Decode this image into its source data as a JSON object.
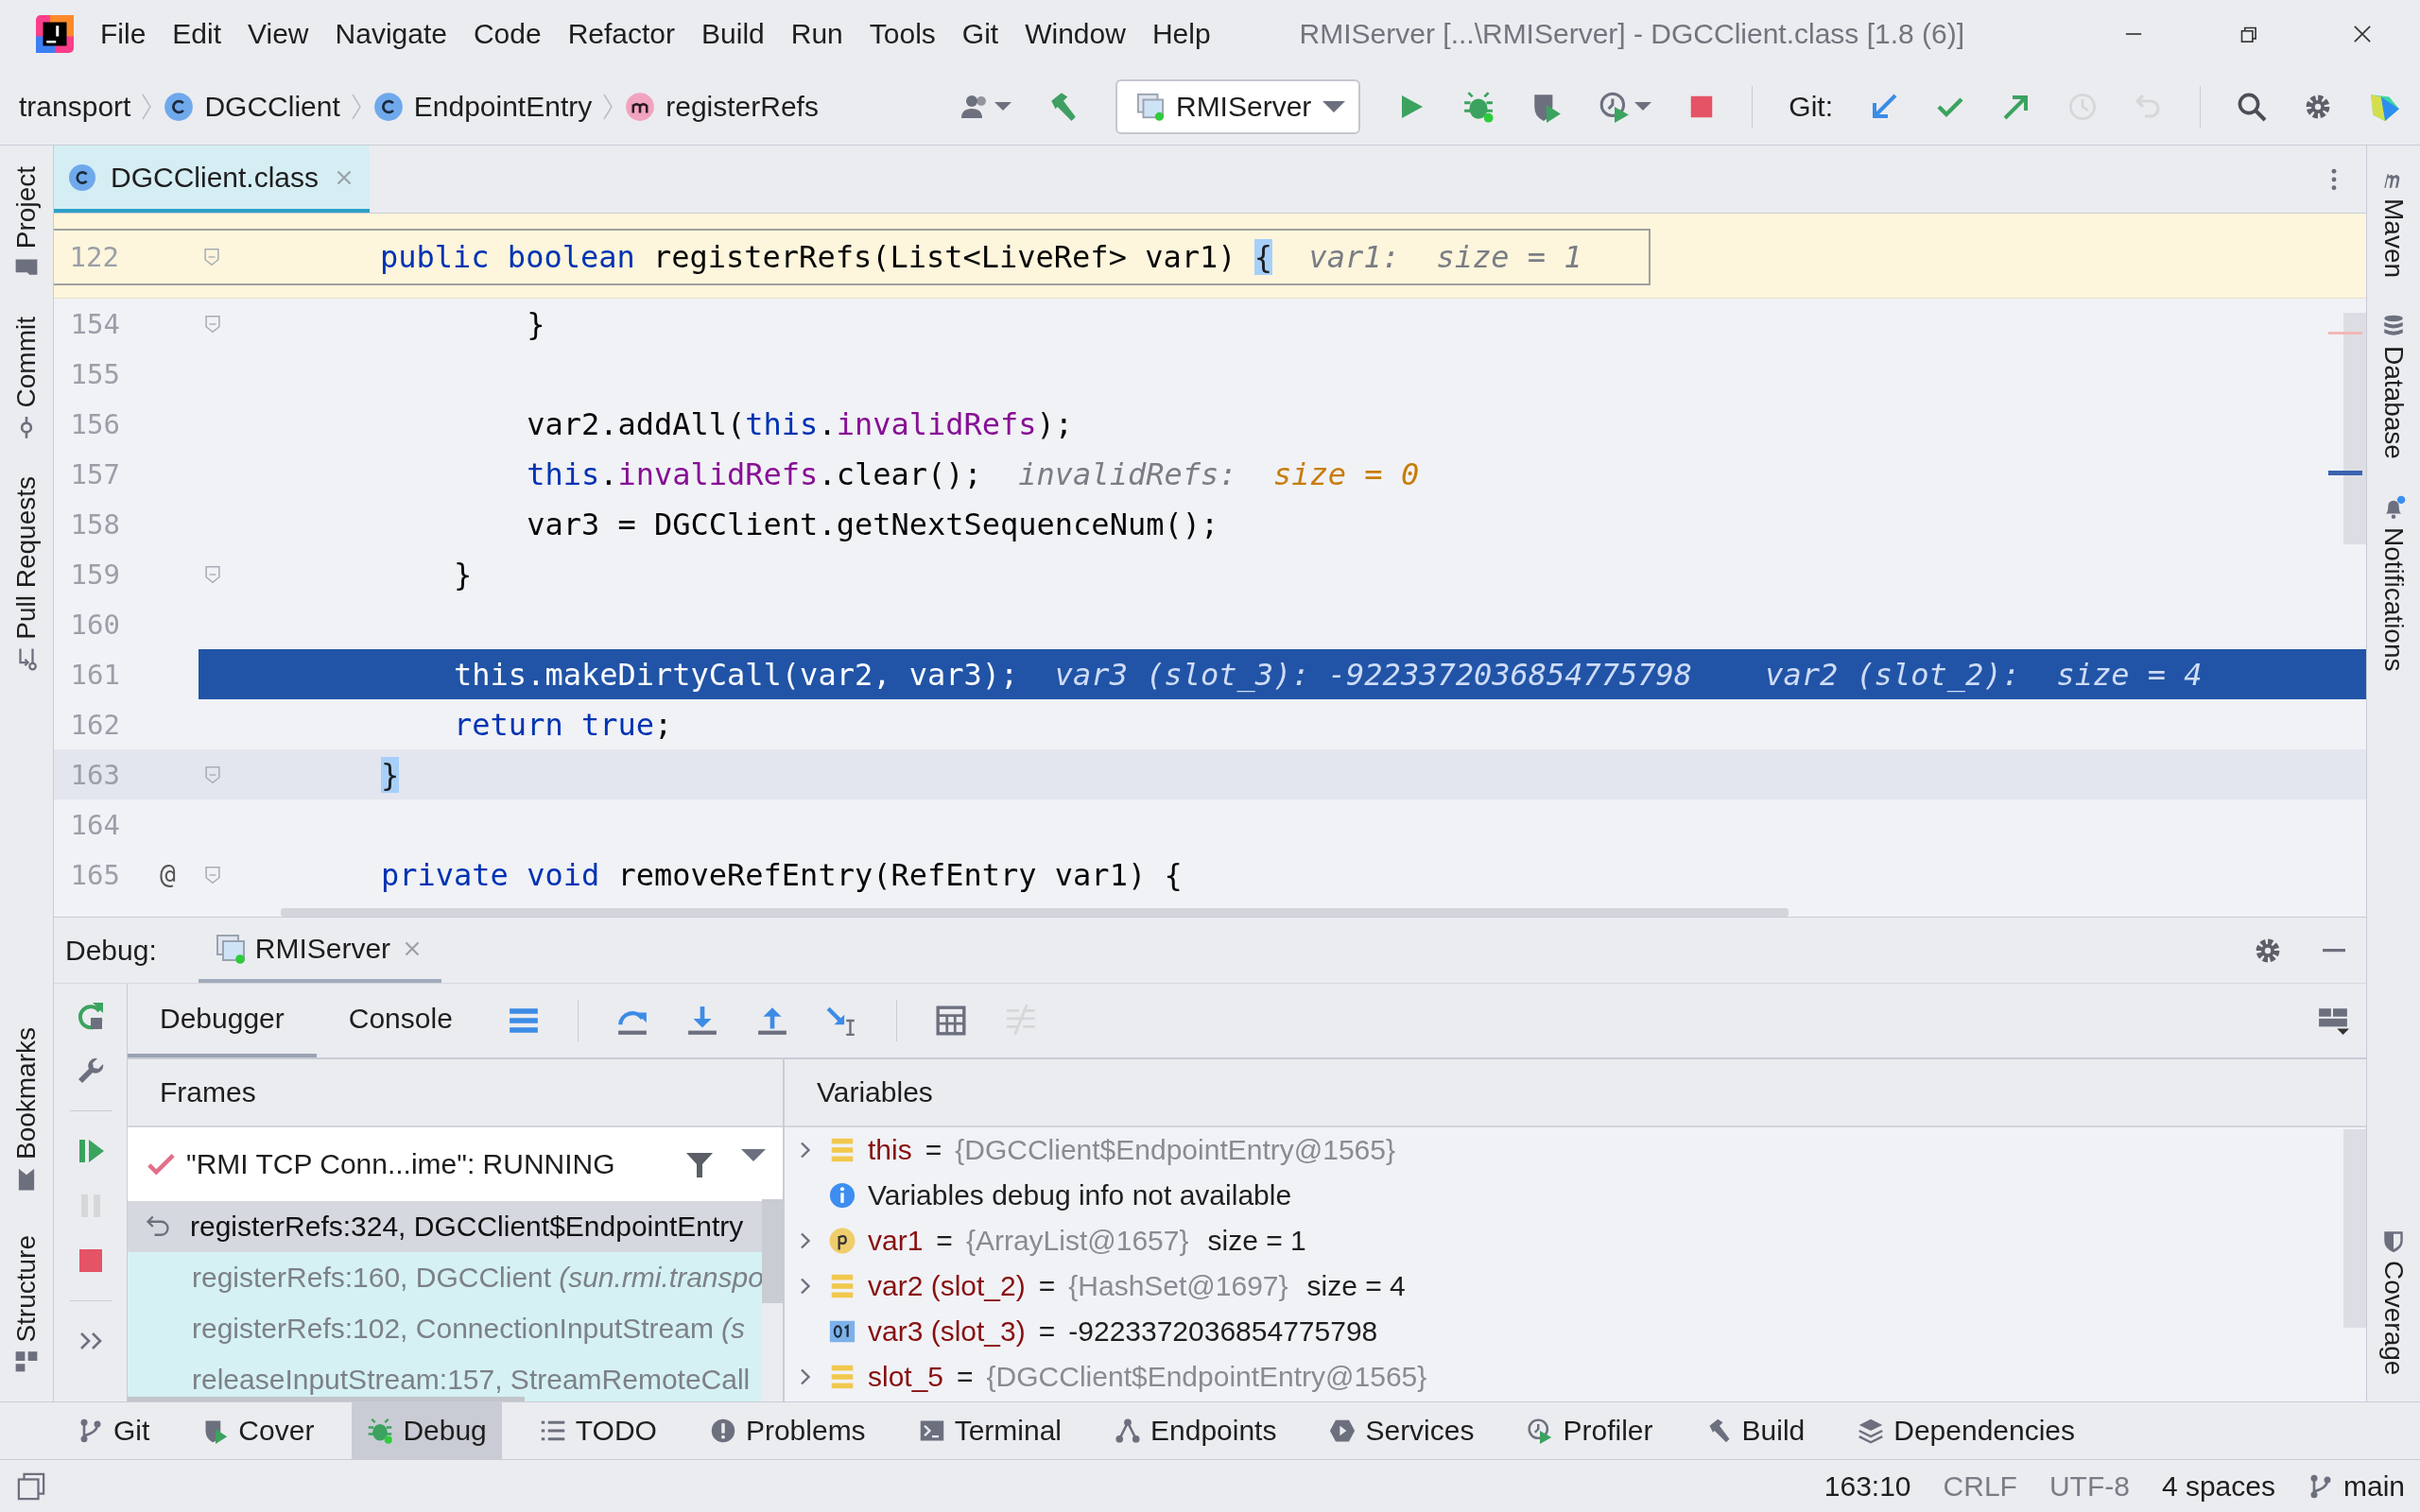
{
  "window": {
    "title": "RMIServer [...\\RMIServer] - DGCClient.class [1.8 (6)]"
  },
  "menu": [
    "File",
    "Edit",
    "View",
    "Navigate",
    "Code",
    "Refactor",
    "Build",
    "Run",
    "Tools",
    "Git",
    "Window",
    "Help"
  ],
  "breadcrumbs": [
    {
      "label": "transport",
      "kind": "package"
    },
    {
      "label": "DGCClient",
      "kind": "class"
    },
    {
      "label": "EndpointEntry",
      "kind": "class"
    },
    {
      "label": "registerRefs",
      "kind": "method"
    }
  ],
  "run_config": {
    "label": "RMIServer"
  },
  "git": {
    "label": "Git:",
    "actions": [
      {
        "kind": "update",
        "disabled": false
      },
      {
        "kind": "commit",
        "disabled": false
      },
      {
        "kind": "push",
        "disabled": false
      },
      {
        "kind": "history",
        "disabled": true
      },
      {
        "kind": "rollback",
        "disabled": true
      }
    ]
  },
  "left_stripe": {
    "top": [
      {
        "label": "Project",
        "kind": "project"
      },
      {
        "label": "Commit",
        "kind": "commit"
      },
      {
        "label": "Pull Requests",
        "kind": "pull-requests"
      }
    ],
    "bottom": [
      {
        "label": "Bookmarks",
        "kind": "bookmarks"
      },
      {
        "label": "Structure",
        "kind": "structure"
      }
    ]
  },
  "right_stripe": {
    "top": [
      {
        "label": "Maven",
        "kind": "maven"
      },
      {
        "label": "Database",
        "kind": "database"
      },
      {
        "label": "Notifications",
        "kind": "notifications"
      }
    ],
    "bottom": [
      {
        "label": "Coverage",
        "kind": "coverage"
      }
    ]
  },
  "editor": {
    "tabs": [
      {
        "label": "DGCClient.class",
        "selected": true
      }
    ],
    "sticky": {
      "number": "122",
      "fold": true,
      "tokens": [
        {
          "text": "public boolean",
          "kind": "kw"
        },
        {
          "text": " registerRefs(List<LiveRef> var1) ",
          "kind": "plain"
        },
        {
          "text": "{",
          "kind": "brace"
        },
        {
          "text": "var1:",
          "kind": "hint"
        },
        {
          "text": "size = 1",
          "kind": "hint-value"
        }
      ]
    },
    "lines": [
      {
        "number": "154",
        "fold": true,
        "execution": false,
        "caret": false,
        "tokens": [
          {
            "text": "        }",
            "kind": "plain"
          }
        ]
      },
      {
        "number": "155",
        "fold": false,
        "execution": false,
        "caret": false
      },
      {
        "number": "156",
        "fold": false,
        "execution": false,
        "caret": false,
        "tokens": [
          {
            "text": "        var2.addAll(",
            "kind": "plain"
          },
          {
            "text": "this",
            "kind": "kw"
          },
          {
            "text": ".",
            "kind": "plain"
          },
          {
            "text": "invalidRefs",
            "kind": "field"
          },
          {
            "text": ");",
            "kind": "plain"
          }
        ]
      },
      {
        "number": "157",
        "fold": false,
        "execution": false,
        "caret": false,
        "tokens": [
          {
            "text": "        this",
            "kind": "kw"
          },
          {
            "text": ".",
            "kind": "plain"
          },
          {
            "text": "invalidRefs",
            "kind": "field"
          },
          {
            "text": ".clear();",
            "kind": "plain"
          },
          {
            "text": "invalidRefs:",
            "kind": "hint"
          },
          {
            "text": "size = 0",
            "kind": "hint-changed"
          }
        ]
      },
      {
        "number": "158",
        "fold": false,
        "execution": false,
        "caret": false,
        "tokens": [
          {
            "text": "        var3 = DGCClient.getNextSequenceNum();",
            "kind": "plain"
          }
        ]
      },
      {
        "number": "159",
        "fold": true,
        "execution": false,
        "caret": false,
        "tokens": [
          {
            "text": "    }",
            "kind": "plain"
          }
        ]
      },
      {
        "number": "160",
        "fold": false,
        "execution": false,
        "caret": false
      },
      {
        "number": "161",
        "fold": false,
        "execution": true,
        "caret": false,
        "tokens": [
          {
            "text": "    this.makeDirtyCall(var2, var3);",
            "kind": "plain"
          },
          {
            "text": "var3 (slot_3): -9223372036854775798",
            "kind": "hint"
          },
          {
            "text": "var2 (slot_2):",
            "kind": "hint"
          },
          {
            "text": "size = 4",
            "kind": "hint-value"
          }
        ]
      },
      {
        "number": "162",
        "fold": false,
        "execution": false,
        "caret": false,
        "tokens": [
          {
            "text": "    return true",
            "kind": "kw"
          },
          {
            "text": ";",
            "kind": "plain"
          }
        ]
      },
      {
        "number": "163",
        "fold": true,
        "execution": false,
        "caret": true,
        "tokens": [
          {
            "text": "}",
            "kind": "brace"
          }
        ]
      },
      {
        "number": "164",
        "fold": false,
        "execution": false,
        "caret": false
      },
      {
        "number": "165",
        "fold": true,
        "execution": false,
        "caret": false,
        "gutter_mark": "@",
        "tokens": [
          {
            "text": "private void",
            "kind": "kw"
          },
          {
            "text": " removeRefEntry(RefEntry var1) {",
            "kind": "plain"
          }
        ]
      }
    ]
  },
  "debug": {
    "label": "Debug:",
    "sessions": [
      {
        "label": "RMIServer",
        "selected": true
      }
    ],
    "side_actions": [
      {
        "kind": "rerun",
        "disabled": false
      },
      {
        "kind": "settings",
        "disabled": false
      },
      {
        "kind": "resume",
        "disabled": false
      },
      {
        "kind": "pause",
        "disabled": true
      },
      {
        "kind": "stop",
        "disabled": false
      },
      {
        "kind": "more",
        "disabled": false
      }
    ],
    "tabs": [
      {
        "label": "Debugger",
        "selected": true
      },
      {
        "label": "Console",
        "selected": false
      }
    ],
    "actions": [
      {
        "kind": "threads",
        "disabled": false
      },
      {
        "kind": "step-over",
        "disabled": false
      },
      {
        "kind": "step-into",
        "disabled": false
      },
      {
        "kind": "step-out",
        "disabled": false
      },
      {
        "kind": "run-to-cursor",
        "disabled": false
      },
      {
        "kind": "evaluate",
        "disabled": false
      },
      {
        "kind": "trace",
        "disabled": true
      }
    ],
    "frames": {
      "title": "Frames",
      "thread": "\"RMI TCP Conn...ime\": RUNNING",
      "items": [
        {
          "method": "registerRefs:324, DGCClient$EndpointEntry",
          "selected": true,
          "library": false
        },
        {
          "method": "registerRefs:160, DGCClient",
          "package": "(sun.rmi.transpo",
          "selected": false,
          "library": true
        },
        {
          "method": "registerRefs:102, ConnectionInputStream",
          "package": "(s",
          "selected": false,
          "library": true
        },
        {
          "method": "releaseInputStream:157, StreamRemoteCall",
          "selected": false,
          "library": true
        }
      ]
    },
    "variables": {
      "title": "Variables",
      "items": [
        {
          "kind": "field",
          "expandable": true,
          "name": "this",
          "operator": "=",
          "value": "{DGCClient$EndpointEntry@1565}"
        },
        {
          "kind": "info",
          "expandable": false,
          "name": "Variables debug info not available"
        },
        {
          "kind": "param",
          "expandable": true,
          "name": "var1",
          "operator": "=",
          "value": "{ArrayList@1657}",
          "extra": "size = 1"
        },
        {
          "kind": "field",
          "expandable": true,
          "name": "var2 (slot_2)",
          "operator": "=",
          "value": "{HashSet@1697}",
          "extra": "size = 4"
        },
        {
          "kind": "primitive",
          "expandable": false,
          "name": "var3 (slot_3)",
          "operator": "=",
          "value": "-9223372036854775798"
        },
        {
          "kind": "field",
          "expandable": true,
          "name": "slot_5",
          "operator": "=",
          "value": "{DGCClient$EndpointEntry@1565}"
        }
      ]
    }
  },
  "tool_windows": [
    {
      "label": "Git",
      "kind": "git",
      "selected": false
    },
    {
      "label": "Cover",
      "kind": "cover",
      "selected": false
    },
    {
      "label": "Debug",
      "kind": "debug",
      "selected": true
    },
    {
      "label": "TODO",
      "kind": "todo",
      "selected": false
    },
    {
      "label": "Problems",
      "kind": "problems",
      "selected": false
    },
    {
      "label": "Terminal",
      "kind": "terminal",
      "selected": false
    },
    {
      "label": "Endpoints",
      "kind": "endpoints",
      "selected": false
    },
    {
      "label": "Services",
      "kind": "services",
      "selected": false
    },
    {
      "label": "Profiler",
      "kind": "profiler",
      "selected": false
    },
    {
      "label": "Build",
      "kind": "build",
      "selected": false
    },
    {
      "label": "Dependencies",
      "kind": "dependencies",
      "selected": false
    }
  ],
  "status_bar": {
    "position": "163:10",
    "line_separator": "CRLF",
    "encoding": "UTF-8",
    "indent": "4 spaces",
    "branch": "main"
  }
}
